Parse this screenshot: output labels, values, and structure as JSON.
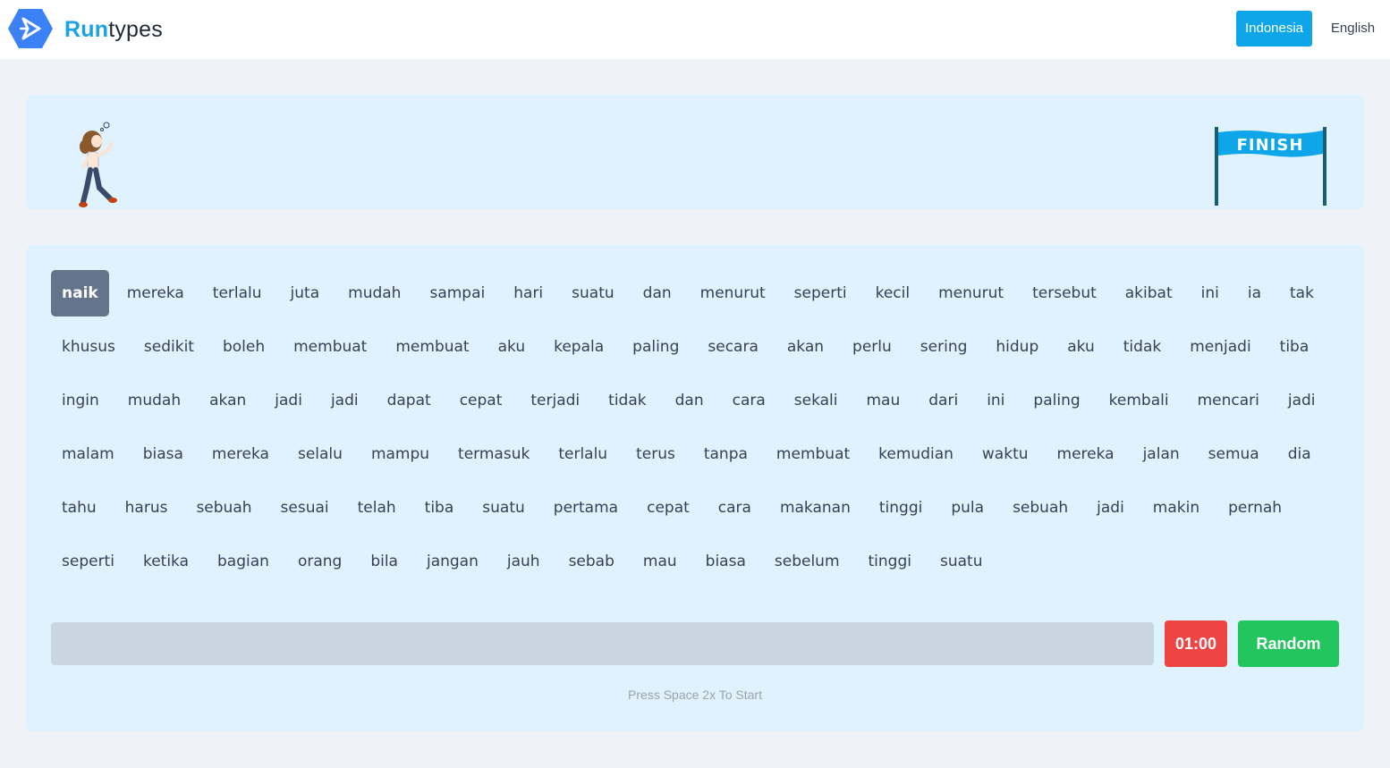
{
  "header": {
    "brand_run": "Run",
    "brand_types": "types",
    "lang_indonesia": "Indonesia",
    "lang_english": "English",
    "accent": "#0ea5e9"
  },
  "track": {
    "finish_label": "FINISH",
    "runner_icon": "walking-girl",
    "finish_icon": "finish-banner"
  },
  "typing": {
    "words": [
      "naik",
      "mereka",
      "terlalu",
      "juta",
      "mudah",
      "sampai",
      "hari",
      "suatu",
      "dan",
      "menurut",
      "seperti",
      "kecil",
      "menurut",
      "tersebut",
      "akibat",
      "ini",
      "ia",
      "tak",
      "khusus",
      "sedikit",
      "boleh",
      "membuat",
      "membuat",
      "aku",
      "kepala",
      "paling",
      "secara",
      "akan",
      "perlu",
      "sering",
      "hidup",
      "aku",
      "tidak",
      "menjadi",
      "tiba",
      "ingin",
      "mudah",
      "akan",
      "jadi",
      "jadi",
      "dapat",
      "cepat",
      "terjadi",
      "tidak",
      "dan",
      "cara",
      "sekali",
      "mau",
      "dari",
      "ini",
      "paling",
      "kembali",
      "mencari",
      "jadi",
      "malam",
      "biasa",
      "mereka",
      "selalu",
      "mampu",
      "termasuk",
      "terlalu",
      "terus",
      "tanpa",
      "membuat",
      "kemudian",
      "waktu",
      "mereka",
      "jalan",
      "semua",
      "dia",
      "tahu",
      "harus",
      "sebuah",
      "sesuai",
      "telah",
      "tiba",
      "suatu",
      "pertama",
      "cepat",
      "cara",
      "makanan",
      "tinggi",
      "pula",
      "sebuah",
      "jadi",
      "makin",
      "pernah",
      "seperti",
      "ketika",
      "bagian",
      "orang",
      "bila",
      "jangan",
      "jauh",
      "sebab",
      "mau",
      "biasa",
      "sebelum",
      "tinggi",
      "suatu"
    ],
    "active_index": 0,
    "input_value": "",
    "timer": "01:00",
    "random_label": "Random",
    "hint": "Press Space 2x To Start",
    "colors": {
      "active_word_bg": "#64748b",
      "timer_bg": "#ef4444",
      "random_bg": "#22c55e"
    }
  }
}
